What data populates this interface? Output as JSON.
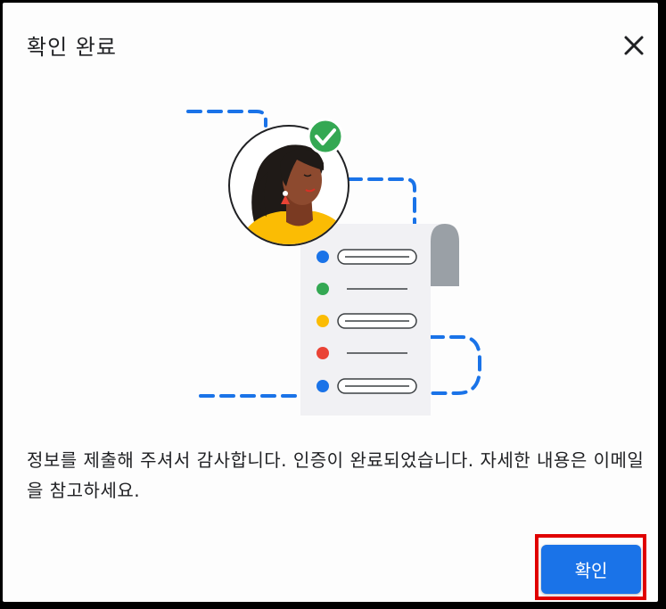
{
  "dialog": {
    "title": "확인 완료",
    "close_icon": "close-icon",
    "message": "정보를 제출해 주셔서 감사합니다. 인증이 완료되었습니다. 자세한 내용은 이메일을 참고하세요.",
    "confirm_label": "확인"
  },
  "illustration": {
    "icons": [
      "check-icon",
      "avatar",
      "document-icon"
    ],
    "colors": {
      "accent_blue": "#1a73e8",
      "check_green": "#34a853",
      "dot_blue": "#1a73e8",
      "dot_green": "#34a853",
      "dot_yellow": "#fbbc04",
      "dot_red": "#ea4335",
      "shirt_yellow": "#fbbc04",
      "paper": "#f1f1f4",
      "scroll_gray": "#9aa0a6"
    }
  },
  "colors": {
    "button_bg": "#1a73e8",
    "button_text": "#ffffff",
    "highlight_border": "#e00000",
    "text": "#202124"
  }
}
